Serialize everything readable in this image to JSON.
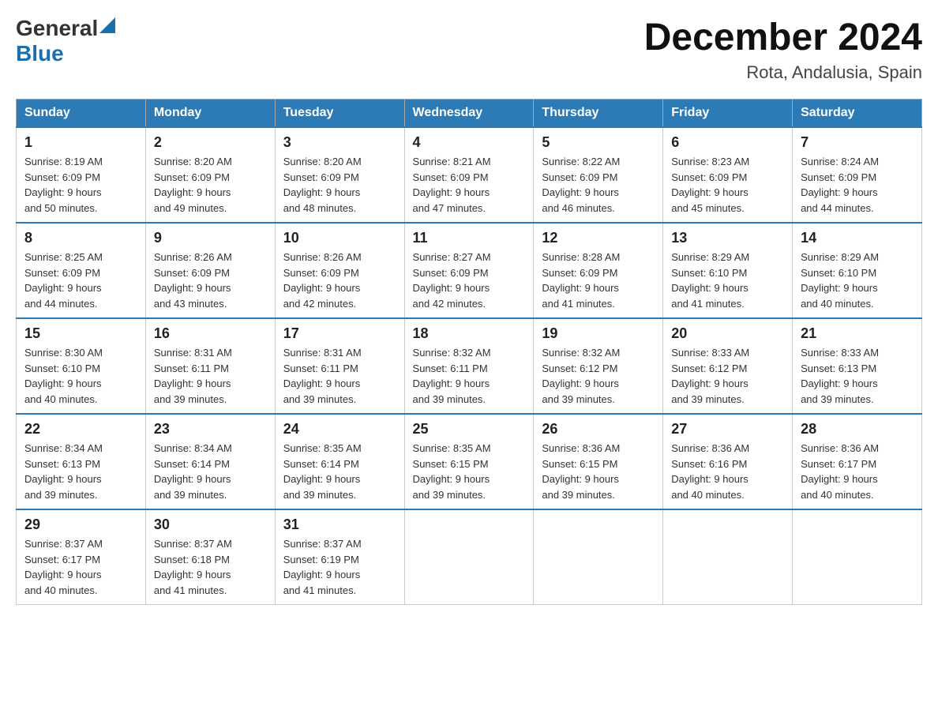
{
  "header": {
    "logo_general": "General",
    "logo_blue": "Blue",
    "month_title": "December 2024",
    "location": "Rota, Andalusia, Spain"
  },
  "days_of_week": [
    "Sunday",
    "Monday",
    "Tuesday",
    "Wednesday",
    "Thursday",
    "Friday",
    "Saturday"
  ],
  "weeks": [
    [
      {
        "day": "1",
        "sunrise": "8:19 AM",
        "sunset": "6:09 PM",
        "daylight": "9 hours and 50 minutes."
      },
      {
        "day": "2",
        "sunrise": "8:20 AM",
        "sunset": "6:09 PM",
        "daylight": "9 hours and 49 minutes."
      },
      {
        "day": "3",
        "sunrise": "8:20 AM",
        "sunset": "6:09 PM",
        "daylight": "9 hours and 48 minutes."
      },
      {
        "day": "4",
        "sunrise": "8:21 AM",
        "sunset": "6:09 PM",
        "daylight": "9 hours and 47 minutes."
      },
      {
        "day": "5",
        "sunrise": "8:22 AM",
        "sunset": "6:09 PM",
        "daylight": "9 hours and 46 minutes."
      },
      {
        "day": "6",
        "sunrise": "8:23 AM",
        "sunset": "6:09 PM",
        "daylight": "9 hours and 45 minutes."
      },
      {
        "day": "7",
        "sunrise": "8:24 AM",
        "sunset": "6:09 PM",
        "daylight": "9 hours and 44 minutes."
      }
    ],
    [
      {
        "day": "8",
        "sunrise": "8:25 AM",
        "sunset": "6:09 PM",
        "daylight": "9 hours and 44 minutes."
      },
      {
        "day": "9",
        "sunrise": "8:26 AM",
        "sunset": "6:09 PM",
        "daylight": "9 hours and 43 minutes."
      },
      {
        "day": "10",
        "sunrise": "8:26 AM",
        "sunset": "6:09 PM",
        "daylight": "9 hours and 42 minutes."
      },
      {
        "day": "11",
        "sunrise": "8:27 AM",
        "sunset": "6:09 PM",
        "daylight": "9 hours and 42 minutes."
      },
      {
        "day": "12",
        "sunrise": "8:28 AM",
        "sunset": "6:09 PM",
        "daylight": "9 hours and 41 minutes."
      },
      {
        "day": "13",
        "sunrise": "8:29 AM",
        "sunset": "6:10 PM",
        "daylight": "9 hours and 41 minutes."
      },
      {
        "day": "14",
        "sunrise": "8:29 AM",
        "sunset": "6:10 PM",
        "daylight": "9 hours and 40 minutes."
      }
    ],
    [
      {
        "day": "15",
        "sunrise": "8:30 AM",
        "sunset": "6:10 PM",
        "daylight": "9 hours and 40 minutes."
      },
      {
        "day": "16",
        "sunrise": "8:31 AM",
        "sunset": "6:11 PM",
        "daylight": "9 hours and 39 minutes."
      },
      {
        "day": "17",
        "sunrise": "8:31 AM",
        "sunset": "6:11 PM",
        "daylight": "9 hours and 39 minutes."
      },
      {
        "day": "18",
        "sunrise": "8:32 AM",
        "sunset": "6:11 PM",
        "daylight": "9 hours and 39 minutes."
      },
      {
        "day": "19",
        "sunrise": "8:32 AM",
        "sunset": "6:12 PM",
        "daylight": "9 hours and 39 minutes."
      },
      {
        "day": "20",
        "sunrise": "8:33 AM",
        "sunset": "6:12 PM",
        "daylight": "9 hours and 39 minutes."
      },
      {
        "day": "21",
        "sunrise": "8:33 AM",
        "sunset": "6:13 PM",
        "daylight": "9 hours and 39 minutes."
      }
    ],
    [
      {
        "day": "22",
        "sunrise": "8:34 AM",
        "sunset": "6:13 PM",
        "daylight": "9 hours and 39 minutes."
      },
      {
        "day": "23",
        "sunrise": "8:34 AM",
        "sunset": "6:14 PM",
        "daylight": "9 hours and 39 minutes."
      },
      {
        "day": "24",
        "sunrise": "8:35 AM",
        "sunset": "6:14 PM",
        "daylight": "9 hours and 39 minutes."
      },
      {
        "day": "25",
        "sunrise": "8:35 AM",
        "sunset": "6:15 PM",
        "daylight": "9 hours and 39 minutes."
      },
      {
        "day": "26",
        "sunrise": "8:36 AM",
        "sunset": "6:15 PM",
        "daylight": "9 hours and 39 minutes."
      },
      {
        "day": "27",
        "sunrise": "8:36 AM",
        "sunset": "6:16 PM",
        "daylight": "9 hours and 40 minutes."
      },
      {
        "day": "28",
        "sunrise": "8:36 AM",
        "sunset": "6:17 PM",
        "daylight": "9 hours and 40 minutes."
      }
    ],
    [
      {
        "day": "29",
        "sunrise": "8:37 AM",
        "sunset": "6:17 PM",
        "daylight": "9 hours and 40 minutes."
      },
      {
        "day": "30",
        "sunrise": "8:37 AM",
        "sunset": "6:18 PM",
        "daylight": "9 hours and 41 minutes."
      },
      {
        "day": "31",
        "sunrise": "8:37 AM",
        "sunset": "6:19 PM",
        "daylight": "9 hours and 41 minutes."
      },
      null,
      null,
      null,
      null
    ]
  ],
  "labels": {
    "sunrise": "Sunrise:",
    "sunset": "Sunset:",
    "daylight": "Daylight:"
  }
}
